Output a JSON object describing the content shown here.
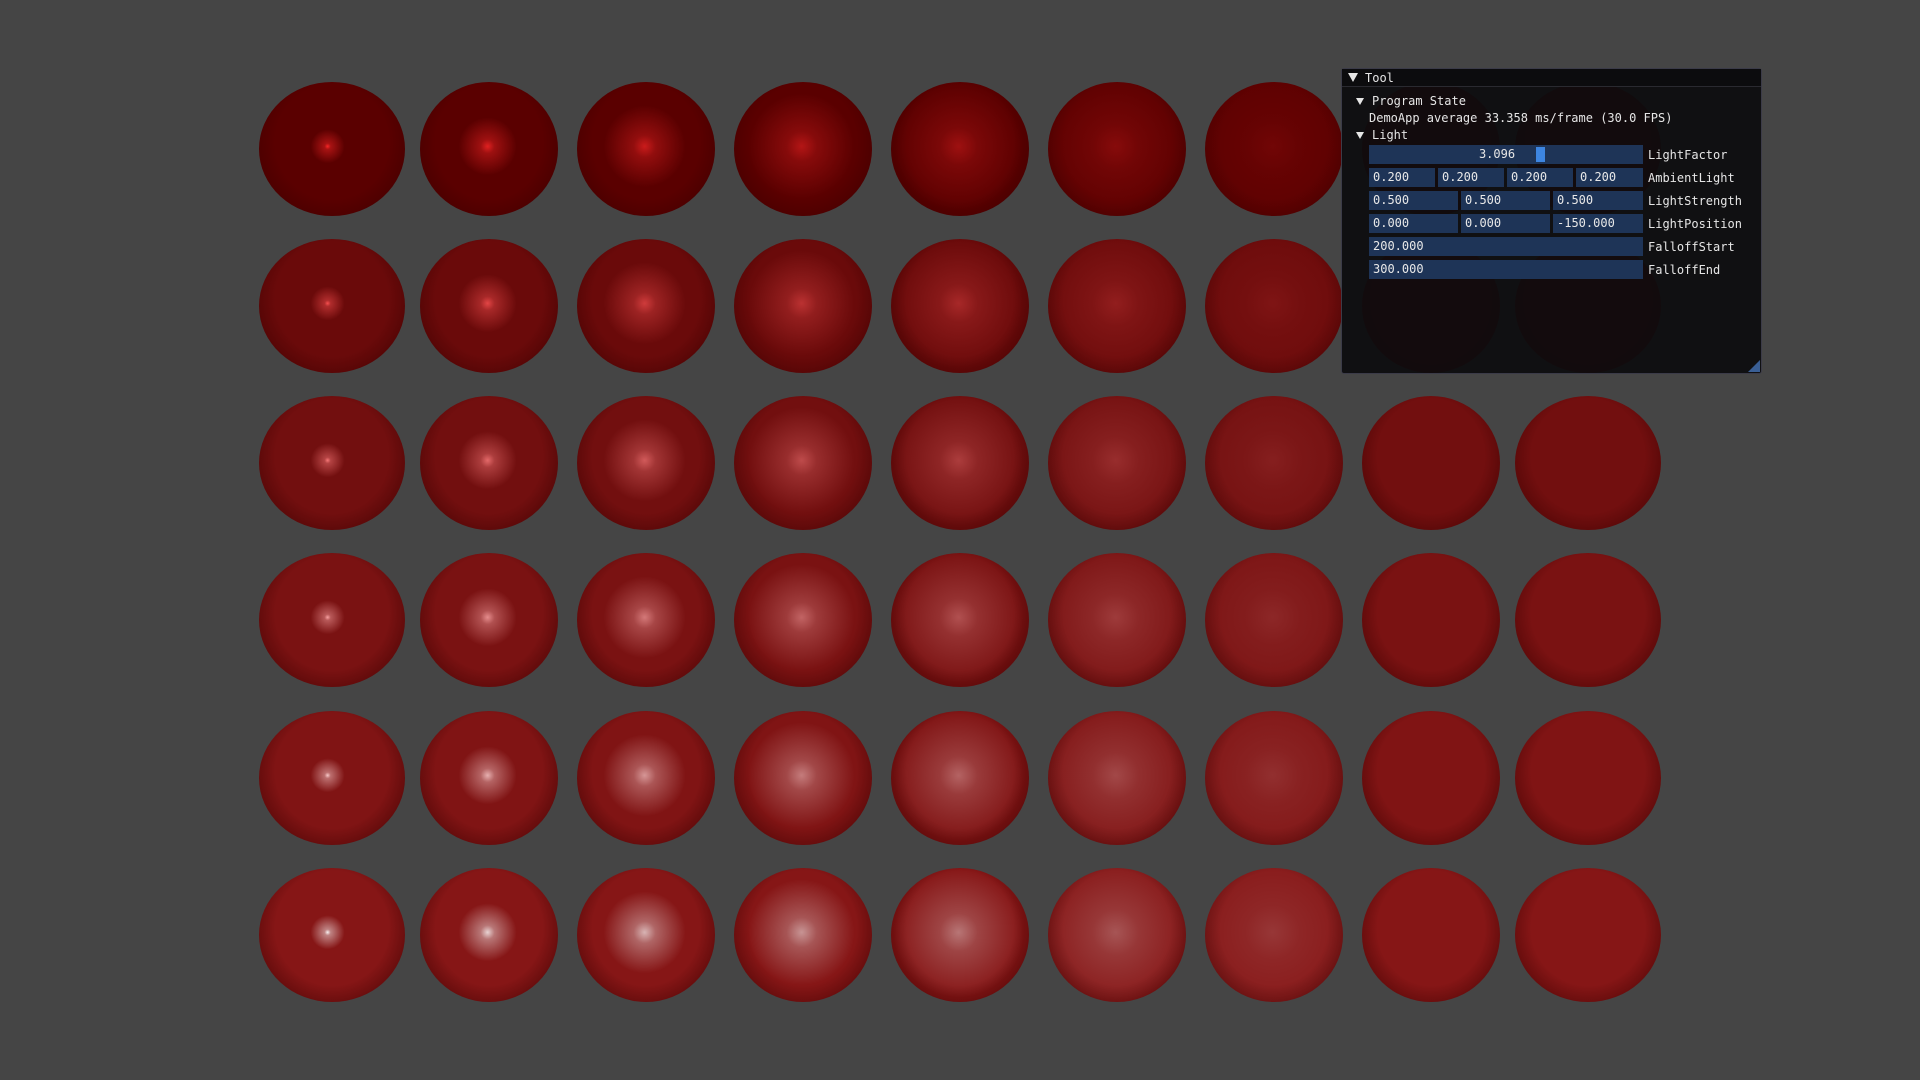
{
  "scene": {
    "background": "#454545",
    "grid": {
      "cols": 9,
      "rows": 6,
      "note_columns": "specular spot shrinks/softens across columns",
      "base_colors": [
        "#5a0000",
        "#6a0a0a",
        "#720f0f",
        "#7a1212",
        "#801414",
        "#861616"
      ],
      "visible_icon": "sphere"
    }
  },
  "tool_window": {
    "title": "Tool",
    "sections": {
      "program_state": {
        "header": "Program State",
        "fps_text": "DemoApp average 33.358 ms/frame (30.0 FPS)"
      },
      "light": {
        "header": "Light",
        "light_factor": {
          "value": "3.096",
          "label": "LightFactor",
          "fill_fraction": 0.62
        },
        "ambient_light": {
          "values": [
            "0.200",
            "0.200",
            "0.200",
            "0.200"
          ],
          "label": "AmbientLight"
        },
        "light_strength": {
          "values": [
            "0.500",
            "0.500",
            "0.500"
          ],
          "label": "LightStrength"
        },
        "light_position": {
          "values": [
            "0.000",
            "0.000",
            "-150.000"
          ],
          "label": "LightPosition"
        },
        "falloff_start": {
          "value": "200.000",
          "label": "FalloffStart"
        },
        "falloff_end": {
          "value": "300.000",
          "label": "FalloffEnd"
        }
      }
    }
  }
}
